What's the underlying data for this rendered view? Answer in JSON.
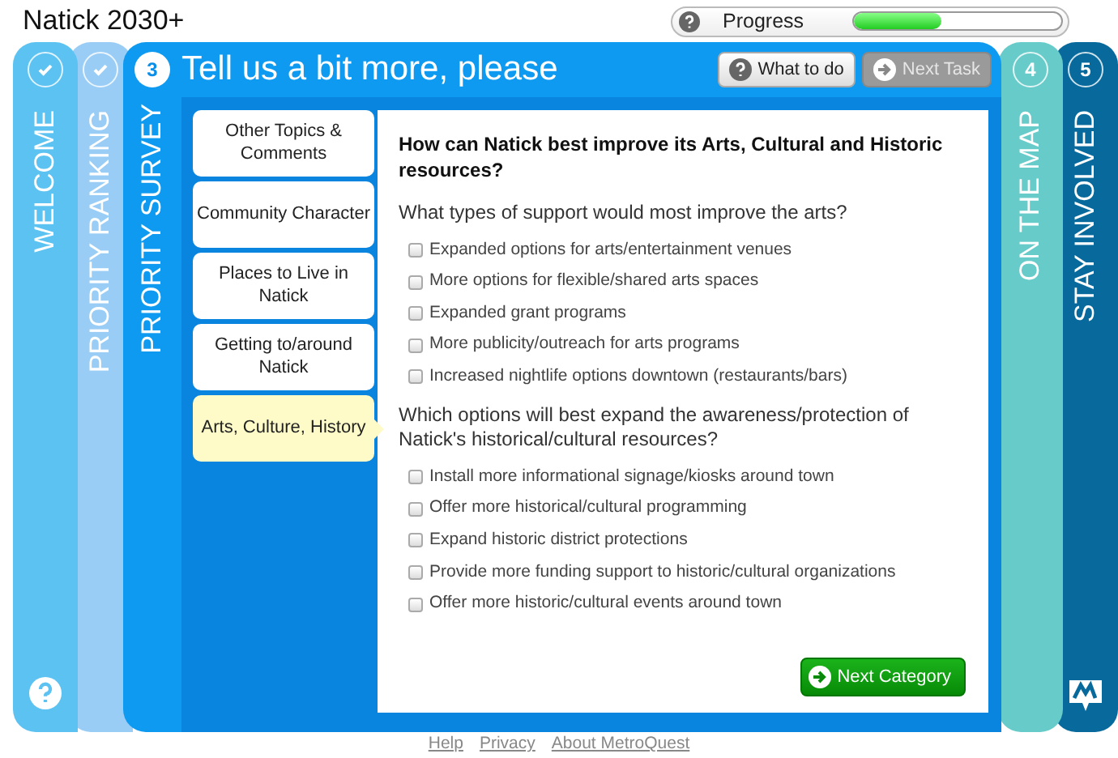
{
  "app_title": "Natick 2030+",
  "progress": {
    "label": "Progress",
    "level": 0.42
  },
  "steps": [
    {
      "kind": "done",
      "label": "WELCOME",
      "color": "#5bc2f2"
    },
    {
      "kind": "done",
      "label": "PRIORITY RANKING",
      "color": "#99cdf6"
    },
    {
      "kind": "current",
      "number": "3",
      "label": "PRIORITY SURVEY",
      "color": "#0d9af0"
    },
    {
      "kind": "upcoming",
      "number": "4",
      "label": "ON THE MAP",
      "color": "#66cbc9"
    },
    {
      "kind": "upcoming",
      "number": "5",
      "label": "STAY INVOLVED",
      "color": "#086a9c"
    }
  ],
  "survey": {
    "title": "Tell us a bit more, please",
    "buttons": [
      {
        "kind": "help",
        "label": "What to do",
        "disabled": false
      },
      {
        "kind": "next",
        "label": "Next Task",
        "disabled": true
      }
    ],
    "categories": [
      {
        "label": "Other Topics & Comments",
        "selected": false
      },
      {
        "label": "Community Character",
        "selected": false
      },
      {
        "label": "Places to Live in Natick",
        "selected": false
      },
      {
        "label": "Getting to/around Natick",
        "selected": false
      },
      {
        "label": "Arts, Culture, History",
        "selected": true
      }
    ],
    "heading": "How can Natick best improve its Arts, Cultural and Historic resources?",
    "questions": [
      {
        "text": "What types of support would most improve the arts?",
        "options": [
          {
            "label": "Expanded options for arts/entertainment venues",
            "checked": false
          },
          {
            "label": "More options for flexible/shared arts spaces",
            "checked": false
          },
          {
            "label": "Expanded grant programs",
            "checked": false
          },
          {
            "label": "More publicity/outreach for arts programs",
            "checked": false
          },
          {
            "label": "Increased nightlife options downtown (restaurants/bars)",
            "checked": false
          }
        ]
      },
      {
        "text": "Which options will best expand the awareness/protection of Natick's historical/cultural resources?",
        "options": [
          {
            "label": "Install more informational signage/kiosks around town",
            "checked": false
          },
          {
            "label": "Offer more historical/cultural programming",
            "checked": false
          },
          {
            "label": "Expand historic district protections",
            "checked": false
          },
          {
            "label": "Provide more funding support to historic/cultural organizations",
            "checked": false
          },
          {
            "label": "Offer more historic/cultural events around town",
            "checked": false
          }
        ]
      }
    ],
    "next_button": "Next Category"
  },
  "footer_links": [
    "Help",
    "Privacy",
    "About MetroQuest"
  ]
}
